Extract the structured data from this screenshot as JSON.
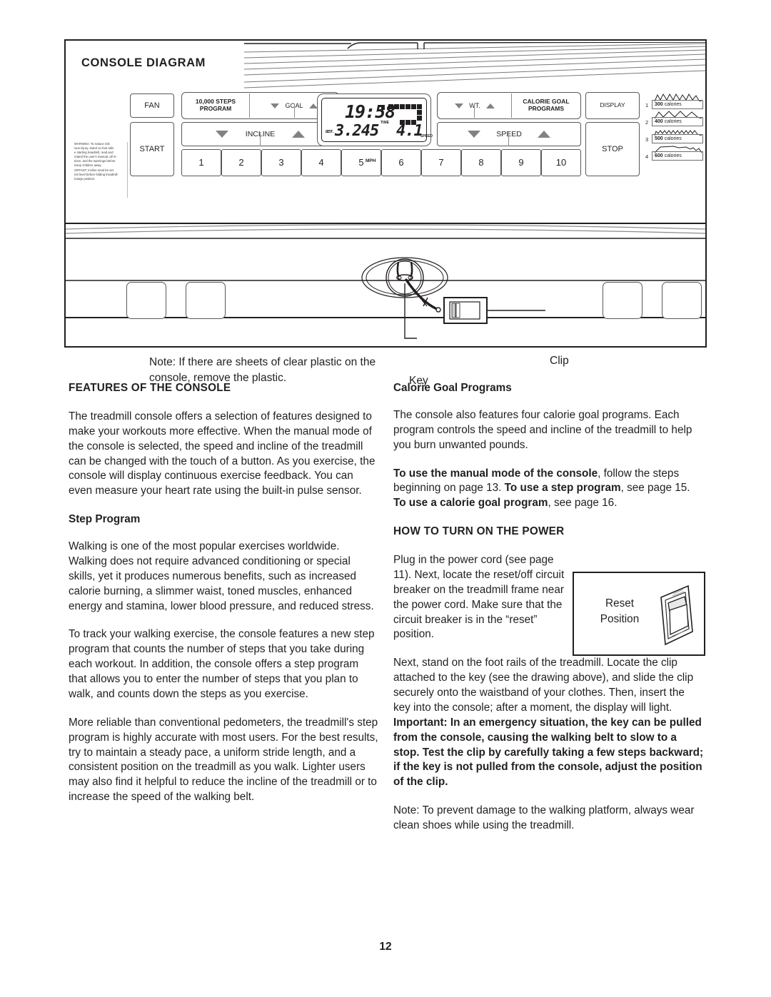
{
  "page": {
    "number": "12"
  },
  "diagram": {
    "title": "CONSOLE DIAGRAM",
    "warning_label": {
      "word": "WARNING:",
      "line1": "To reduce risk",
      "line2": "ious injury, stand on foot rails",
      "line3": "e starting treadmill, read and",
      "line4": "rstand the user's manual, all in-",
      "line5": "tions, and the warnings before",
      "line6": "Keep children away.",
      "line7": "ORTANT: Incline must be set",
      "line8": "est level before folding treadmill",
      "line9": "torage position."
    },
    "buttons": {
      "fan": "FAN",
      "steps_program_l1": "10,000 STEPS",
      "steps_program_l2": "PROGRAM",
      "goal": "GOAL",
      "incline": "INCLINE",
      "start": "START",
      "wt": "WT.",
      "calorie_goal_l1": "CALORIE GOAL",
      "calorie_goal_l2": "PROGRAMS",
      "display": "DISPLAY",
      "speed": "SPEED",
      "stop": "STOP"
    },
    "speed_keys": [
      "1",
      "2",
      "3",
      "4",
      "5",
      "6",
      "7",
      "8",
      "9",
      "10"
    ],
    "mph_label": "MPH",
    "lcd": {
      "time_value": "19:58",
      "time_label": "TIME",
      "dist_label": "DIST.",
      "dist_value": "3.245",
      "speed_value": "4.1",
      "speed_label": "SPEED"
    },
    "calorie_programs": [
      {
        "index": "1",
        "calories": "300",
        "unit": "calories"
      },
      {
        "index": "2",
        "calories": "400",
        "unit": "calories"
      },
      {
        "index": "3",
        "calories": "500",
        "unit": "calories"
      },
      {
        "index": "4",
        "calories": "600",
        "unit": "calories"
      }
    ],
    "note_plastic": "Note: If there are sheets of clear plastic on the console, remove the plastic.",
    "label_key": "Key",
    "label_clip": "Clip"
  },
  "left_column": {
    "heading": "FEATURES OF THE CONSOLE",
    "intro": "The treadmill console offers a selection of features designed to make your workouts more effective. When the manual mode of the console is selected, the speed and incline of the treadmill can be changed with the touch of a button. As you exercise, the console will display continuous exercise feedback. You can even measure your heart rate using the built-in pulse sensor.",
    "step_program_heading": "Step Program",
    "step_p1": "Walking is one of the most popular exercises worldwide. Walking does not require advanced conditioning or special skills, yet it produces numerous benefits, such as increased calorie burning, a slimmer waist, toned muscles, enhanced energy and stamina, lower blood pressure, and reduced stress.",
    "step_p2": "To track your walking exercise, the console features a new step program that counts the number of steps that you take during each workout. In addition, the console offers a step program that allows you to enter the number of steps that you plan to walk, and counts down the steps as you exercise.",
    "step_p3": "More reliable than conventional pedometers, the treadmill's step program is highly accurate with most users. For the best results, try to maintain a steady pace, a uniform stride length, and a consistent position on the treadmill as you walk. Lighter users may also find it helpful to reduce the incline of the treadmill or to increase the speed of the walking belt."
  },
  "right_column": {
    "calorie_heading": "Calorie Goal Programs",
    "calorie_p1": "The console also features four calorie goal programs. Each program controls the speed and incline of the treadmill to help you burn unwanted pounds.",
    "modes_b1": "To use the manual mode of the console",
    "modes_t1": ", follow the steps beginning on page 13. ",
    "modes_b2": "To use a step program",
    "modes_t2": ", see page 15. ",
    "modes_b3": "To use a calorie goal program",
    "modes_t3": ", see page 16.",
    "power_heading": "HOW TO TURN ON THE POWER",
    "power_p1": "Plug in the power cord (see page 11). Next, locate the reset/off circuit breaker on the treadmill frame near the power cord. Make sure that the circuit breaker is in the “reset” position.",
    "reset_fig_l1": "Reset",
    "reset_fig_l2": "Position",
    "power_p2_plain": "Next, stand on the foot rails of the treadmill. Locate the clip attached to the key (see the drawing above), and slide the clip securely onto the waistband of your clothes. Then, insert the key into the console; after a moment, the display will light. ",
    "power_p2_bold": "Important: In an emergency situation, the key can be pulled from the console, causing the walking belt to slow to a stop. Test the clip by carefully taking a few steps backward; if the key is not pulled from the console, adjust the position of the clip.",
    "note_shoes": "Note: To prevent damage to the walking platform, always wear clean shoes while using the treadmill."
  }
}
